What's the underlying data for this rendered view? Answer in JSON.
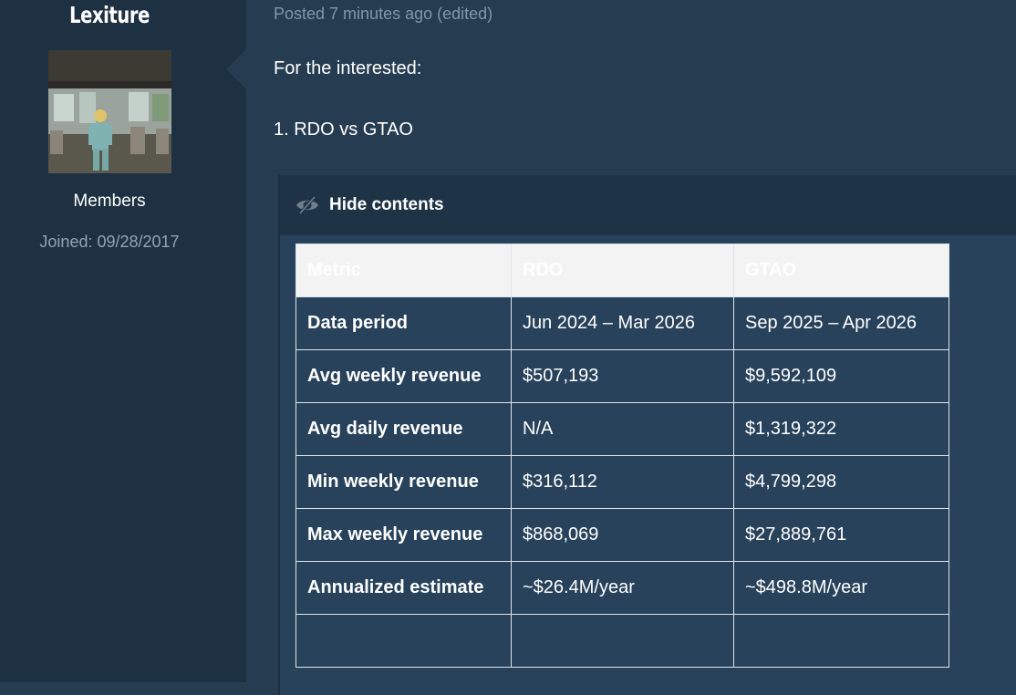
{
  "author": {
    "name": "Lexiture",
    "group": "Members",
    "joined": "Joined: 09/28/2017"
  },
  "post": {
    "meta": "Posted 7 minutes ago (edited)",
    "lines": [
      "For the interested:",
      "1. RDO vs GTAO"
    ]
  },
  "spoiler": {
    "icon": "eye-slash-icon",
    "label": "Hide contents"
  },
  "table": {
    "headers": [
      "Metric",
      "RDO",
      "GTAO"
    ],
    "rows": [
      [
        "Data period",
        "Jun 2024 – Mar 2026",
        "Sep 2025 – Apr 2026"
      ],
      [
        "Avg weekly revenue",
        "$507,193",
        "$9,592,109"
      ],
      [
        "Avg daily revenue",
        "N/A",
        "$1,319,322"
      ],
      [
        "Min weekly revenue",
        "$316,112",
        "$4,799,298"
      ],
      [
        "Max weekly revenue",
        "$868,069",
        "$27,889,761"
      ],
      [
        "Annualized estimate",
        "~$26.4M/year",
        "~$498.8M/year"
      ],
      [
        "",
        "",
        ""
      ]
    ]
  },
  "colors": {
    "page_bg": "#263d51",
    "sidebar_bg": "#1e3142",
    "spoiler_header_bg": "#1e3345",
    "meta_text": "#7f97ab"
  }
}
